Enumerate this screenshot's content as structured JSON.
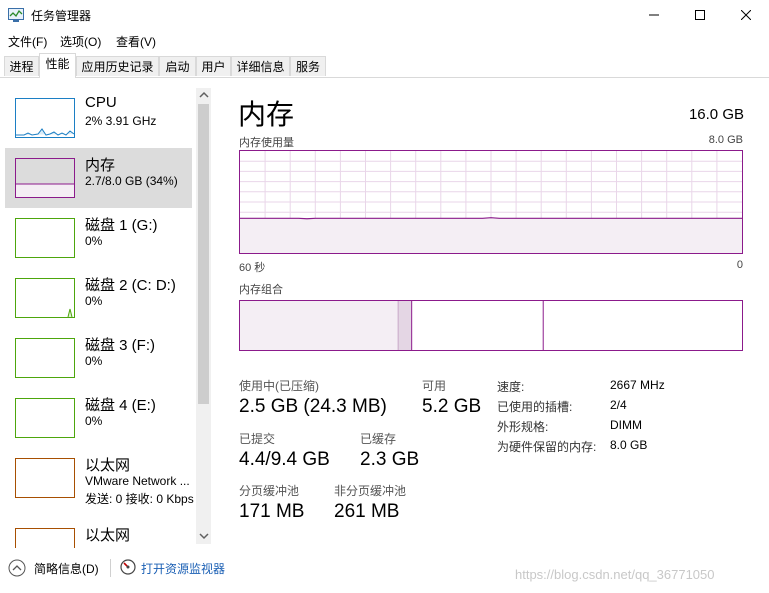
{
  "window": {
    "title": "任务管理器",
    "minimize": "—",
    "maximize": "☐",
    "close": "✕"
  },
  "menu": [
    "文件(F)",
    "选项(O)",
    "查看(V)"
  ],
  "tabs": [
    "进程",
    "性能",
    "应用历史记录",
    "启动",
    "用户",
    "详细信息",
    "服务"
  ],
  "active_tab": "性能",
  "sidebar": {
    "items": [
      {
        "name": "CPU",
        "sub": "2% 3.91 GHz",
        "sub2": "",
        "color": "#1c7fc4"
      },
      {
        "name": "内存",
        "sub": "2.7/8.0 GB (34%)",
        "sub2": "",
        "color": "#8b1a8b"
      },
      {
        "name": "磁盘 1 (G:)",
        "sub": "0%",
        "sub2": "",
        "color": "#4da60c"
      },
      {
        "name": "磁盘 2 (C: D:)",
        "sub": "0%",
        "sub2": "",
        "color": "#4da60c"
      },
      {
        "name": "磁盘 3 (F:)",
        "sub": "0%",
        "sub2": "",
        "color": "#4da60c"
      },
      {
        "name": "磁盘 4 (E:)",
        "sub": "0%",
        "sub2": "",
        "color": "#4da60c"
      },
      {
        "name": "以太网",
        "sub": "VMware Network ...",
        "sub2": "发送: 0 接收: 0 Kbps",
        "color": "#a74f01"
      },
      {
        "name": "以太网",
        "sub": "",
        "sub2": "",
        "color": "#a74f01"
      }
    ]
  },
  "detail": {
    "title": "内存",
    "total": "16.0 GB",
    "usage_label": "内存使用量",
    "usage_max": "8.0 GB",
    "time_left": "60 秒",
    "time_right": "0",
    "composition_label": "内存组合",
    "usage_fraction": 0.34,
    "composition": {
      "in_use": 0.315,
      "modified": 0.027,
      "standby": 0.262
    },
    "stats": {
      "in_use_label": "使用中(已压缩)",
      "in_use_value": "2.5 GB (24.3 MB)",
      "available_label": "可用",
      "available_value": "5.2 GB",
      "committed_label": "已提交",
      "committed_value": "4.4/9.4 GB",
      "cached_label": "已缓存",
      "cached_value": "2.3 GB",
      "paged_label": "分页缓冲池",
      "paged_value": "171 MB",
      "nonpaged_label": "非分页缓冲池",
      "nonpaged_value": "261 MB"
    },
    "specs": {
      "speed_label": "速度:",
      "speed_value": "2667 MHz",
      "slots_label": "已使用的插槽:",
      "slots_value": "2/4",
      "form_label": "外形规格:",
      "form_value": "DIMM",
      "reserved_label": "为硬件保留的内存:",
      "reserved_value": "8.0 GB"
    }
  },
  "bottom": {
    "summary": "简略信息(D)",
    "resmon": "打开资源监视器",
    "watermark": "https://blog.csdn.net/qq_36771050"
  },
  "colors": {
    "memory": "#8b1a8b",
    "memory_fill": "#f4eef4",
    "grid": "#e9d6e9",
    "link": "#1a5fb4"
  }
}
